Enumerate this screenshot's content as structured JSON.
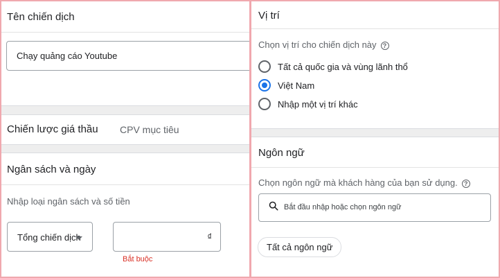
{
  "left": {
    "campaign_name": {
      "title": "Tên chiến dịch",
      "value": "Chạy quảng cáo Youtube"
    },
    "bidding": {
      "title": "Chiến lược giá thầu",
      "value": "CPV mục tiêu"
    },
    "budget": {
      "title": "Ngân sách và ngày",
      "prompt": "Nhập loại ngân sách và số tiền",
      "type_selected": "Tổng chiến dịch",
      "currency_symbol": "₫",
      "amount_value": "",
      "error": "Bắt buộc"
    }
  },
  "right": {
    "location": {
      "title": "Vị trí",
      "prompt": "Chọn vị trí cho chiến dịch này",
      "options": [
        {
          "label": "Tất cả quốc gia và vùng lãnh thổ",
          "selected": false
        },
        {
          "label": "Việt Nam",
          "selected": true
        },
        {
          "label": "Nhập một vị trí khác",
          "selected": false
        }
      ]
    },
    "language": {
      "title": "Ngôn ngữ",
      "prompt": "Chọn ngôn ngữ mà khách hàng của bạn sử dụng.",
      "search_placeholder": "Bắt đầu nhập hoặc chọn ngôn ngữ",
      "chip": "Tất cả ngôn ngữ"
    }
  },
  "colors": {
    "accent": "#1a73e8",
    "error": "#d93025",
    "frame": "#f0a8ae"
  }
}
